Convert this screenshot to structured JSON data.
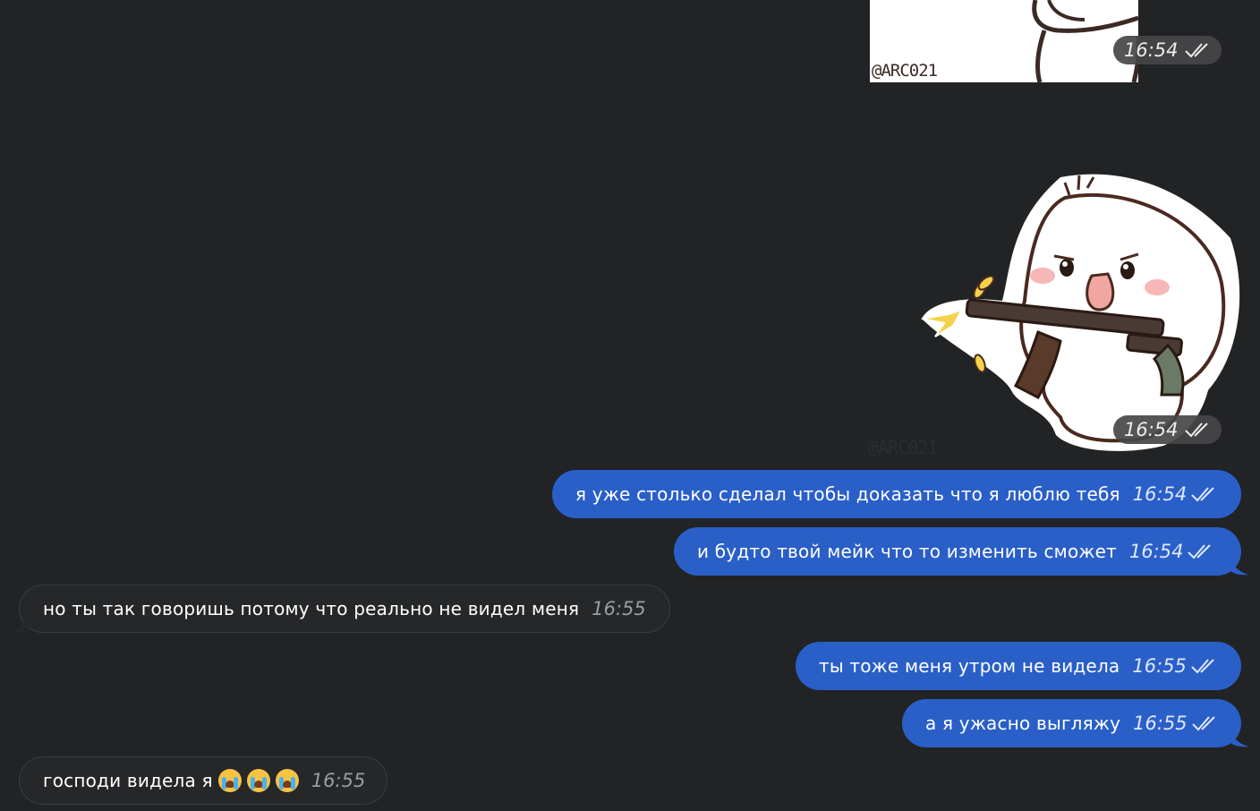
{
  "messages": [
    {
      "id": "sticker-1",
      "type": "sticker",
      "direction": "out",
      "time": "16:54",
      "credit": "@ARC021"
    },
    {
      "id": "sticker-2",
      "type": "sticker",
      "direction": "out",
      "time": "16:54",
      "credit": "@ARC021"
    },
    {
      "id": "msg-1",
      "type": "text",
      "direction": "out",
      "text": "я уже столько сделал чтобы доказать что я люблю тебя",
      "time": "16:54"
    },
    {
      "id": "msg-2",
      "type": "text",
      "direction": "out",
      "text": "и будто твой мейк что то изменить сможет",
      "time": "16:54"
    },
    {
      "id": "msg-3",
      "type": "text",
      "direction": "in",
      "text": "но ты так говоришь потому что реально не видел меня",
      "time": "16:55"
    },
    {
      "id": "msg-4",
      "type": "text",
      "direction": "out",
      "text": "ты тоже меня утром не видела",
      "time": "16:55"
    },
    {
      "id": "msg-5",
      "type": "text",
      "direction": "out",
      "text": "а я ужасно выгляжу",
      "time": "16:55"
    },
    {
      "id": "msg-6",
      "type": "text",
      "direction": "in",
      "text": "господи видела я",
      "emoji": [
        "loudly-crying-face",
        "loudly-crying-face",
        "loudly-crying-face"
      ],
      "time": "16:55"
    }
  ],
  "colors": {
    "background": "#212325",
    "outgoing_bubble": "#2a5fc8",
    "incoming_bubble": "#262729"
  }
}
